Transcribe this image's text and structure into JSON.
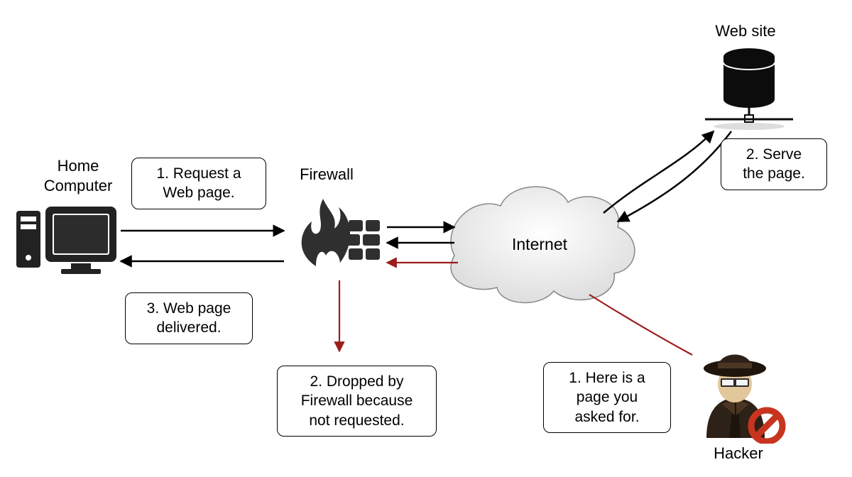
{
  "nodes": {
    "computer": {
      "label": "Home\nComputer"
    },
    "firewall": {
      "label": "Firewall"
    },
    "internet": {
      "label": "Internet"
    },
    "website": {
      "label": "Web site"
    },
    "hacker": {
      "label": "Hacker"
    }
  },
  "callouts": {
    "requestPage": "1. Request a\nWeb page.",
    "servePage": "2. Serve\nthe page.",
    "pageDelivered": "3. Web page\ndelivered.",
    "droppedByFw": "2. Dropped by\nFirewall because\nnot requested.",
    "hackerMessage": "1. Here is a\npage you\nasked for."
  },
  "colors": {
    "black": "#000000",
    "firewallDark": "#2f2f2f",
    "attackRed": "#9c1c1c",
    "hackerBrown": "#3b2a1c",
    "hackerSkin": "#e2c79b",
    "hackerRed": "#c8351f",
    "cloudFill": "#eeeeee"
  }
}
